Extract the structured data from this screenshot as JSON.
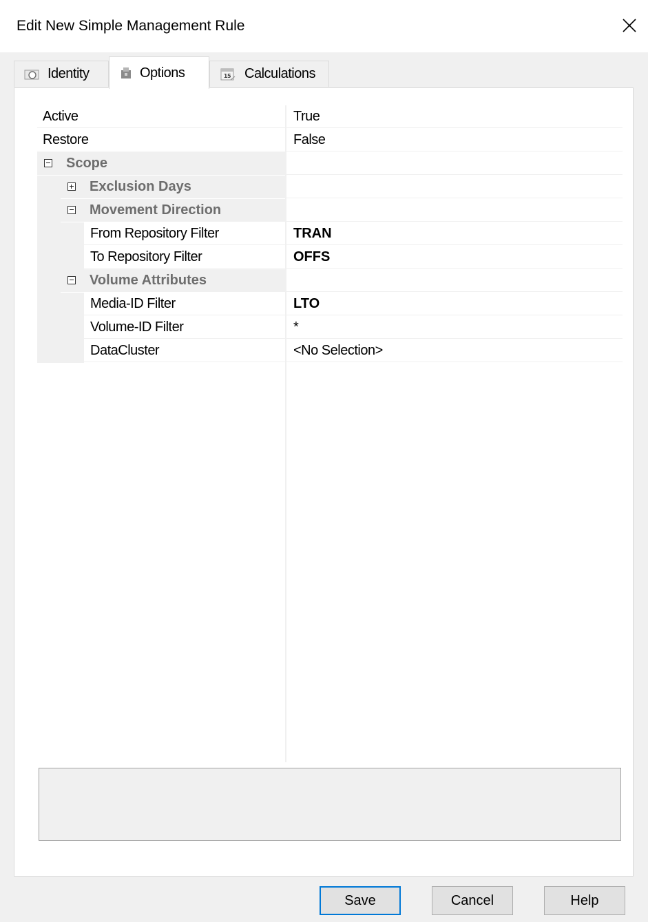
{
  "window": {
    "title": "Edit New Simple Management Rule"
  },
  "tabs": [
    {
      "label": "Identity",
      "icon": "identity-icon"
    },
    {
      "label": "Options",
      "icon": "options-icon",
      "selected": true
    },
    {
      "label": "Calculations",
      "icon": "calendar-icon",
      "icon_text": "15"
    }
  ],
  "properties": {
    "active": {
      "name": "Active",
      "value": "True"
    },
    "restore": {
      "name": "Restore",
      "value": "False"
    },
    "scope": {
      "name": "Scope",
      "expanded": true
    },
    "exclusion_days": {
      "name": "Exclusion Days",
      "expanded": false
    },
    "movement_direction": {
      "name": "Movement Direction",
      "expanded": true
    },
    "from_repository": {
      "name": "From Repository Filter",
      "value": "TRAN"
    },
    "to_repository": {
      "name": "To Repository Filter",
      "value": "OFFS"
    },
    "volume_attributes": {
      "name": "Volume Attributes",
      "expanded": true
    },
    "media_id": {
      "name": "Media-ID Filter",
      "value": "LTO"
    },
    "volume_id": {
      "name": "Volume-ID Filter",
      "value": "*"
    },
    "datacluster": {
      "name": "DataCluster",
      "value": "<No Selection>"
    }
  },
  "buttons": {
    "save": "Save",
    "cancel": "Cancel",
    "help": "Help"
  },
  "colors": {
    "dialog_bg": "#f0f0f0",
    "category_text": "#6d6d6d",
    "default_button_border": "#0078d7"
  }
}
